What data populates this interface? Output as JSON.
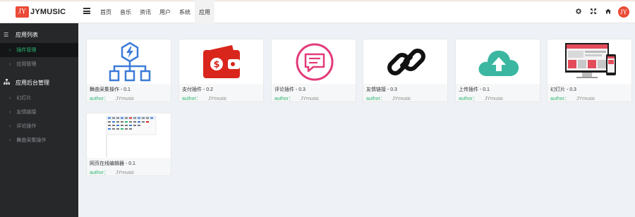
{
  "header": {
    "logo_badge": "JY",
    "logo_text": "JYMUSIC",
    "nav": [
      "首页",
      "音乐",
      "资讯",
      "用户",
      "系统",
      "应用"
    ],
    "icons": [
      "gear-icon",
      "expand-icon",
      "home-icon"
    ],
    "avatar": "JY"
  },
  "sidebar": {
    "groups": [
      {
        "label": "应用列表",
        "icon": "list-icon",
        "items": [
          {
            "label": "插件管理",
            "active": true
          },
          {
            "label": "应用管理",
            "active": false
          }
        ]
      },
      {
        "label": "应用后台管理",
        "icon": "sitemap-icon",
        "items": [
          {
            "label": "幻灯片",
            "active": false
          },
          {
            "label": "友情链接",
            "active": false
          },
          {
            "label": "评论操作",
            "active": false
          },
          {
            "label": "舞曲采集操作",
            "active": false
          }
        ]
      }
    ]
  },
  "plugins": [
    {
      "title": "舞曲采集操作 - 0.1",
      "author_label": "author：",
      "author": "JYmusic",
      "icon": "sitemap-lightning-icon"
    },
    {
      "title": "支付插件 - 0.2",
      "author_label": "author：",
      "author": "JYmusic",
      "icon": "wallet-icon"
    },
    {
      "title": "评论插件 - 0.3",
      "author_label": "author：",
      "author": "JYmusic",
      "icon": "comment-icon"
    },
    {
      "title": "友情链接 - 0.3",
      "author_label": "author：",
      "author": "JYmusic",
      "icon": "link-icon"
    },
    {
      "title": "上传插件 - 0.1",
      "author_label": "author：",
      "author": "JYmusic",
      "icon": "cloud-upload-icon"
    },
    {
      "title": "幻灯片 - 0.3",
      "author_label": "author：",
      "author": "JYmusic",
      "icon": "slideshow-preview-icon"
    },
    {
      "title": "网页在线编辑器 - 0.1",
      "author_label": "author：",
      "author": "JYmusic",
      "icon": "editor-preview-icon"
    }
  ],
  "colors": {
    "brand": "#ea4b37",
    "accent": "#2bb673",
    "sidebar": "#26282a",
    "icon_blue": "#3c7bd8",
    "wallet_red": "#d9261c",
    "comment_pink": "#e23a79",
    "cloud_teal": "#3bb7a1"
  }
}
